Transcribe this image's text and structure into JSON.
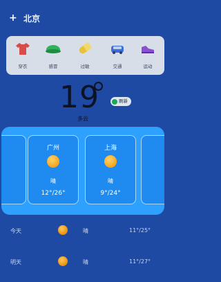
{
  "header": {
    "add_symbol": "+",
    "city": "北京"
  },
  "life_index": [
    {
      "icon": "shirt-icon",
      "label": "穿衣",
      "color": "#d94a4a"
    },
    {
      "icon": "hat-icon",
      "label": "感冒",
      "color": "#2fb35a"
    },
    {
      "icon": "pill-icon",
      "label": "过敏",
      "color": "#e8c23a"
    },
    {
      "icon": "car-icon",
      "label": "交通",
      "color": "#3a6fd8"
    },
    {
      "icon": "shoe-icon",
      "label": "运动",
      "color": "#8a4fd0"
    }
  ],
  "current": {
    "temperature": "19",
    "condition": "多云",
    "refresh_label": "刷新"
  },
  "cities": [
    {
      "name": "广州",
      "condition": "晴",
      "temps": "12°/26°"
    },
    {
      "name": "上海",
      "condition": "晴",
      "temps": "9°/24°"
    }
  ],
  "forecast": [
    {
      "day": "今天",
      "condition": "晴",
      "temps": "11°/25°"
    },
    {
      "day": "明天",
      "condition": "晴",
      "temps": "11°/27°"
    }
  ]
}
